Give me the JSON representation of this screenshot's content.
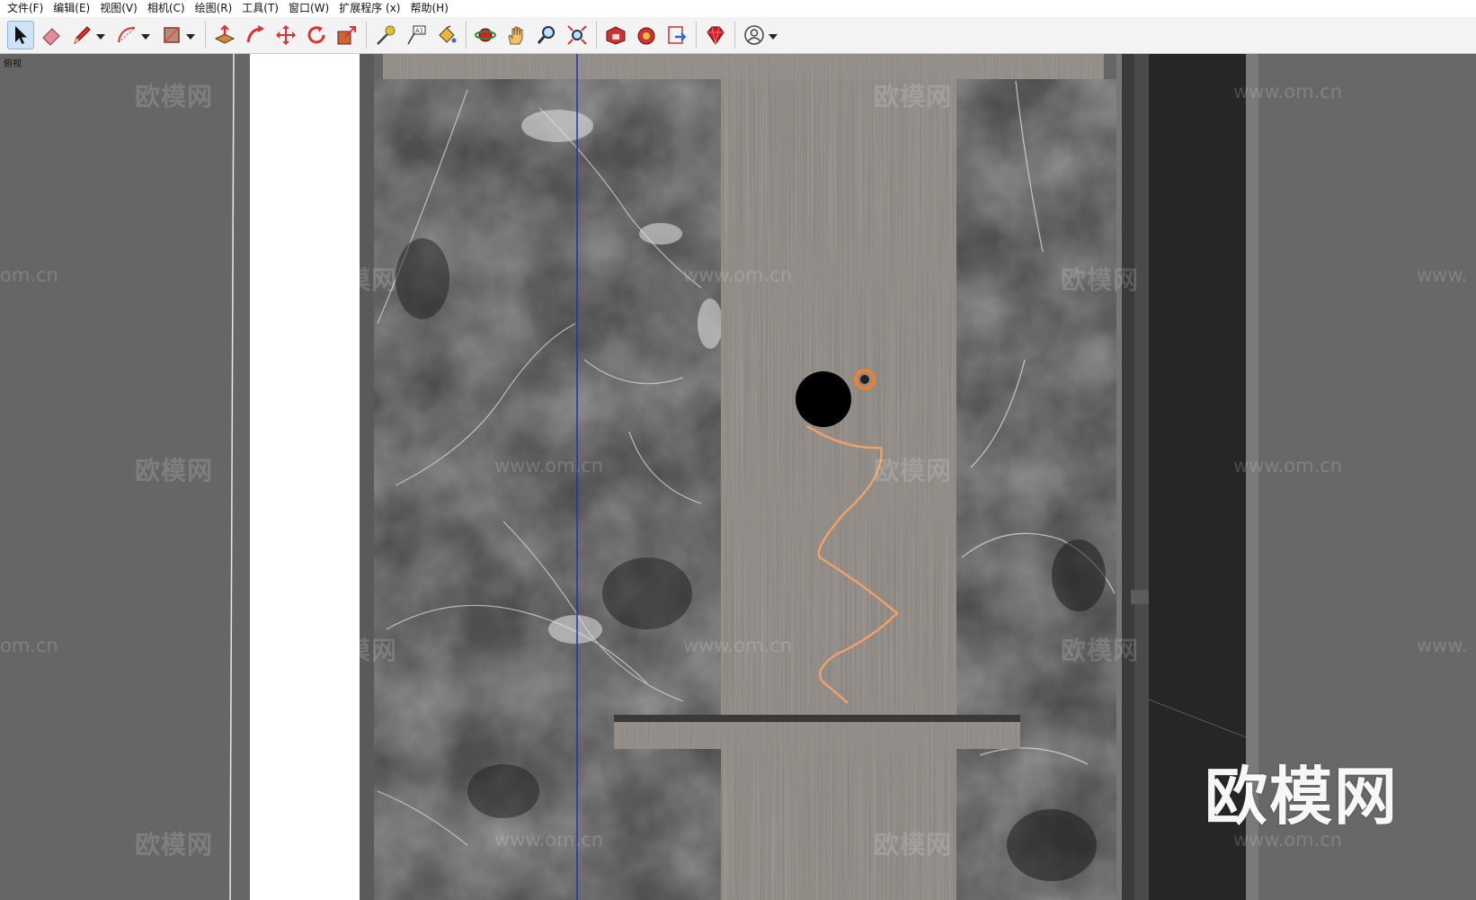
{
  "menu": {
    "items": [
      {
        "label": "文件(F)"
      },
      {
        "label": "编辑(E)"
      },
      {
        "label": "视图(V)"
      },
      {
        "label": "相机(C)"
      },
      {
        "label": "绘图(R)"
      },
      {
        "label": "工具(T)"
      },
      {
        "label": "窗口(W)"
      },
      {
        "label": "扩展程序 (x)"
      },
      {
        "label": "帮助(H)"
      }
    ]
  },
  "toolbar": {
    "tools": [
      {
        "icon": "select-arrow-icon",
        "active": true
      },
      {
        "icon": "eraser-icon"
      },
      {
        "icon": "pencil-icon",
        "dropdown": true
      },
      {
        "icon": "arc-icon",
        "dropdown": true
      },
      {
        "icon": "rectangle-icon",
        "dropdown": true
      },
      {
        "icon": "push-pull-icon"
      },
      {
        "icon": "follow-me-icon"
      },
      {
        "icon": "move-icon"
      },
      {
        "icon": "rotate-icon"
      },
      {
        "icon": "scale-icon"
      },
      {
        "icon": "tape-measure-icon"
      },
      {
        "icon": "text-label-icon"
      },
      {
        "icon": "paint-bucket-icon"
      },
      {
        "icon": "orbit-icon"
      },
      {
        "icon": "pan-hand-icon"
      },
      {
        "icon": "zoom-icon"
      },
      {
        "icon": "zoom-extents-icon"
      },
      {
        "icon": "warehouse-icon"
      },
      {
        "icon": "extension-warehouse-icon"
      },
      {
        "icon": "send-to-layout-icon"
      },
      {
        "icon": "ruby-console-icon"
      },
      {
        "icon": "account-user-icon",
        "dropdown": true
      }
    ]
  },
  "viewport": {
    "scene_label": "俯视",
    "watermarks": {
      "brand": "欧模网",
      "url": "www.om.cn",
      "url_partial_left": "om.cn",
      "url_partial_right": "www."
    },
    "colors": {
      "background": "#666666",
      "marble": "#4f4f4f",
      "wood_strip": "#8b8680",
      "white_band": "#ffffff",
      "dark_frame": "#2a2a2a",
      "axis_blue": "#1f2fbf",
      "path_orange": "#f0a068"
    }
  }
}
